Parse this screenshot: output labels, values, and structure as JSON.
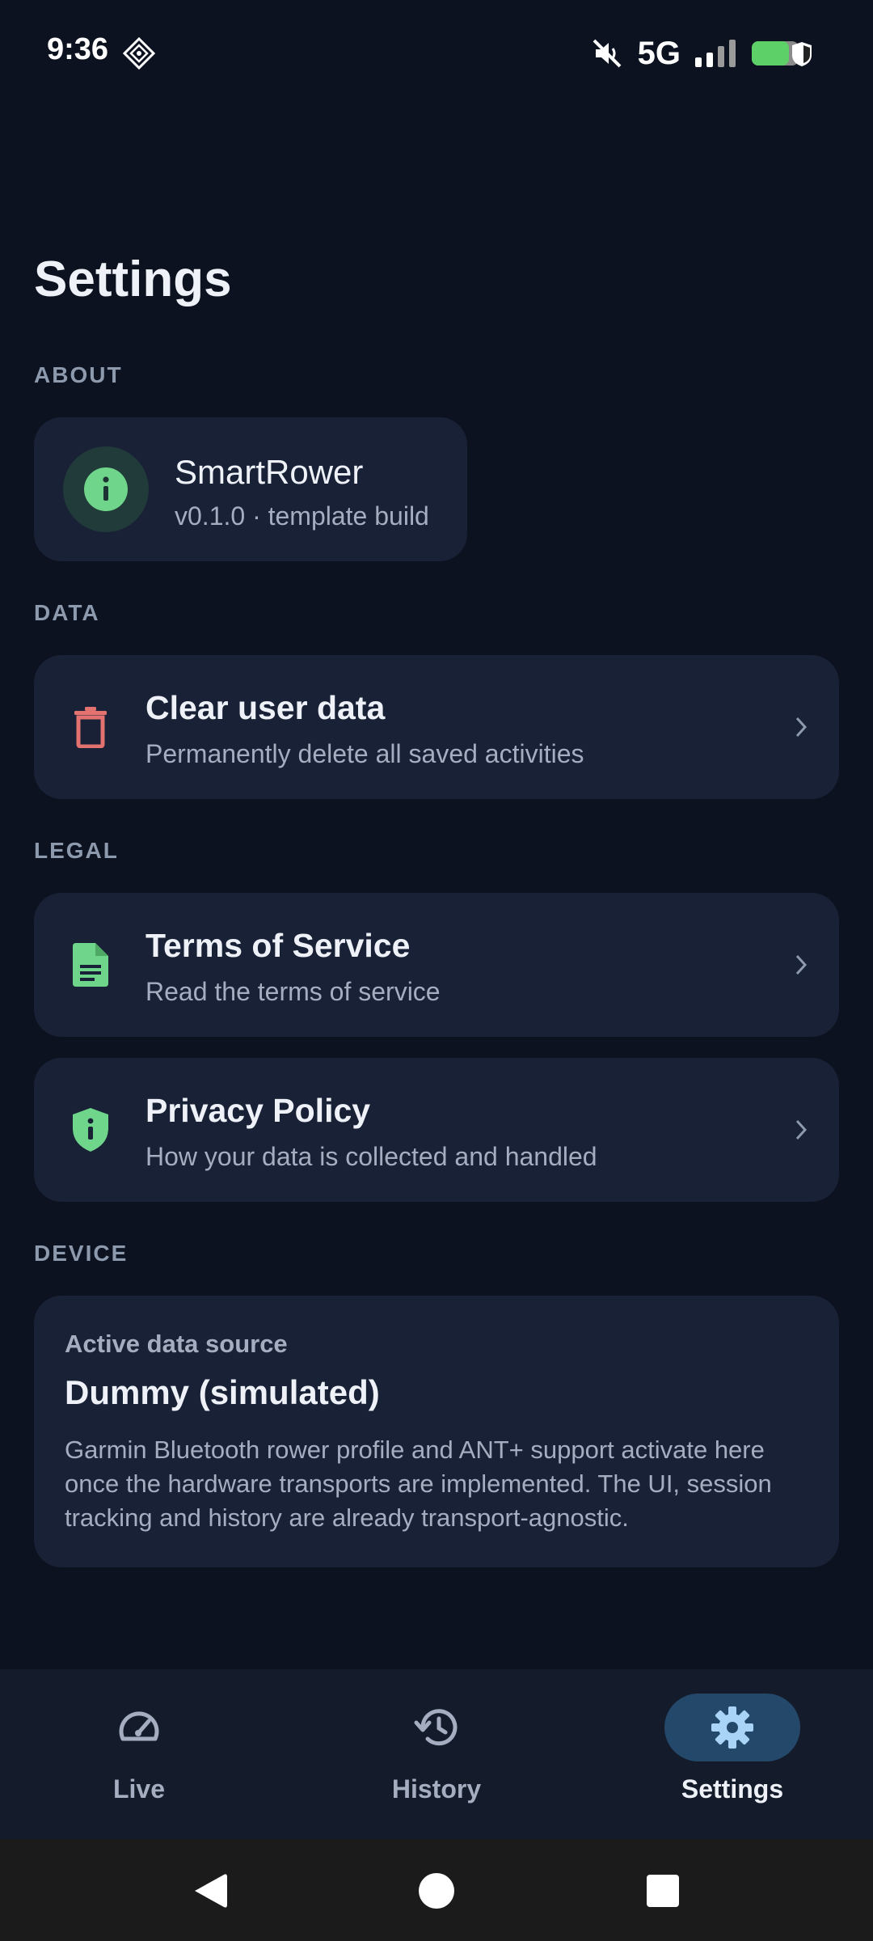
{
  "status_bar": {
    "time": "9:36",
    "network": "5G",
    "battery_level": 0.8
  },
  "page": {
    "title": "Settings"
  },
  "sections": {
    "about": "ABOUT",
    "data": "DATA",
    "legal": "LEGAL",
    "device": "DEVICE"
  },
  "about": {
    "app_name": "SmartRower",
    "version": "v0.1.0 · template build",
    "icon": "info-icon"
  },
  "data": {
    "clear": {
      "title": "Clear user data",
      "subtitle": "Permanently delete all saved activities",
      "icon": "trash-icon"
    }
  },
  "legal": {
    "terms": {
      "title": "Terms of Service",
      "subtitle": "Read the terms of service",
      "icon": "document-icon"
    },
    "privacy": {
      "title": "Privacy Policy",
      "subtitle": "How your data is collected and handled",
      "icon": "shield-info-icon"
    }
  },
  "device": {
    "label": "Active data source",
    "value": "Dummy (simulated)",
    "description": "Garmin Bluetooth rower profile and ANT+ support activate here once the hardware transports are implemented. The UI, session tracking and history are already transport-agnostic."
  },
  "nav": {
    "live": "Live",
    "history": "History",
    "settings": "Settings",
    "active": "settings"
  },
  "colors": {
    "background": "#0c1220",
    "card": "#182135",
    "accent_green": "#6fd58a",
    "danger_red": "#e2716f",
    "nav_active": "#23486a",
    "nav_active_icon": "#a9d4f7"
  }
}
